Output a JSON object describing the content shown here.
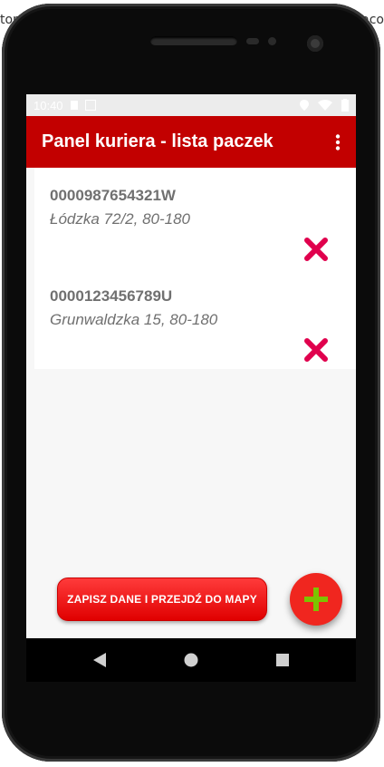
{
  "background": {
    "left_fragment": "tom",
    "right_fragment": "raco"
  },
  "status_bar": {
    "time": "10:40"
  },
  "app_bar": {
    "title": "Panel kuriera - lista paczek"
  },
  "parcels": [
    {
      "code": "0000987654321W",
      "address": "Łódzka 72/2, 80-180"
    },
    {
      "code": "0000123456789U",
      "address": "Grunwaldzka 15, 80-180"
    }
  ],
  "actions": {
    "save_label": "ZAPISZ DANE I PRZEJDŹ DO MAPY"
  },
  "colors": {
    "app_bar": "#c20000",
    "delete_icon": "#e0004d",
    "fab": "#f0261f",
    "fab_icon": "#7cc400"
  },
  "icons": {
    "menu": "more-vert-icon",
    "delete": "close-icon",
    "fab": "plus-icon",
    "nav_back": "back-triangle-icon",
    "nav_home": "home-circle-icon",
    "nav_recents": "recents-square-icon"
  }
}
